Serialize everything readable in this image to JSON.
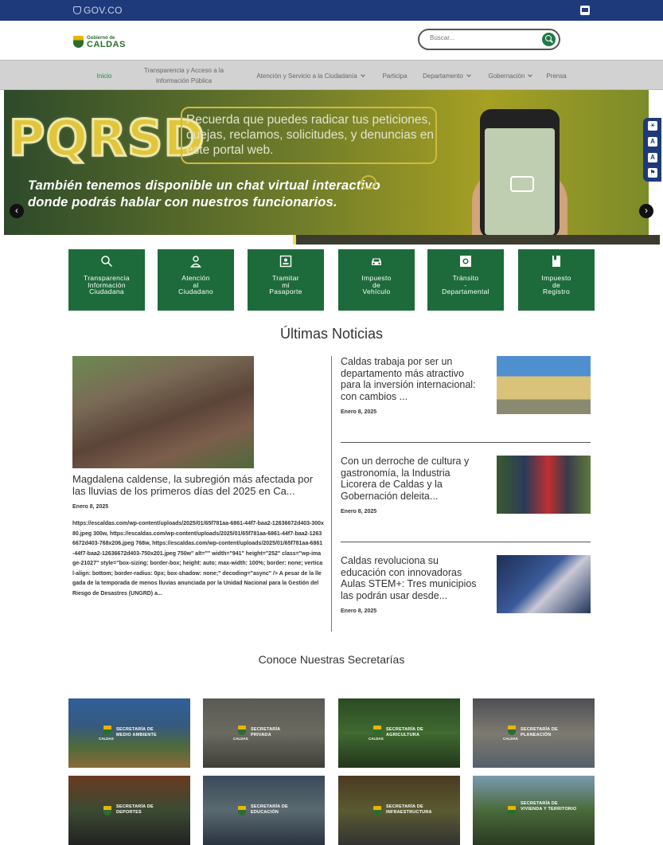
{
  "govbar": {
    "brand": "GOV.CO"
  },
  "logo": {
    "small": "Gobierno de",
    "big": "CALDAS"
  },
  "search": {
    "placeholder": "Buscar..."
  },
  "nav": {
    "items": [
      {
        "label": "Inicio",
        "active": true
      },
      {
        "label": "Transparencia y Acceso a la Información Pública"
      },
      {
        "label": "Atención y Servicio a la Ciudadanía",
        "dropdown": true
      },
      {
        "label": "Participa"
      },
      {
        "label": "Departamento",
        "dropdown": true
      },
      {
        "label": "Gobernación",
        "dropdown": true
      },
      {
        "label": "Prensa"
      }
    ]
  },
  "banner": {
    "headline": "PQRSD",
    "box_text": "Recuerda que puedes radicar tus peticiones, quejas, reclamos, solicitudes, y denuncias en este portal web.",
    "chat_text": "También tenemos disponible un chat virtual interactivo donde podrás hablar con nuestros funcionarios."
  },
  "tiles": [
    {
      "label": "Transparencia\nInformación\nCiudadana",
      "icon": "search-icon"
    },
    {
      "label": "Atención\nal\nCiudadano",
      "icon": "user-icon"
    },
    {
      "label": "Tramitar\nmi\nPasaporte",
      "icon": "id-card-icon"
    },
    {
      "label": "Impuesto\nde\nVehículo",
      "icon": "car-icon"
    },
    {
      "label": "Tránsito\n-\nDepartamental",
      "icon": "camera-icon"
    },
    {
      "label": "Impuesto\nde\nRegistro",
      "icon": "bookmark-icon"
    }
  ],
  "news": {
    "title": "Últimas Noticias",
    "main": {
      "title": "Magdalena caldense, la subregión más afectada por las lluvias de los primeros días del 2025 en Ca...",
      "date": "Enero 8, 2025",
      "excerpt": "https://escaldas.com/wp-content/uploads/2025/01/65f781aa-6861-44f7-baa2-12636672d403-300x80.jpeg 300w, https://escaldas.com/wp-content/uploads/2025/01/65f781aa-6861-44f7-baa2-12636672d403-768x206.jpeg 768w, https://escaldas.com/wp-content/uploads/2025/01/65f781aa-6861-44f7-baa2-12636672d403-750x201.jpeg 750w\" alt=\"\" width=\"941\" height=\"252\" class=\"wp-image-21027\" style=\"box-sizing: border-box; height: auto; max-width: 100%; border: none; vertical-align: bottom; border-radius: 0px; box-shadow: none;\" decoding=\"async\" /> A pesar de la llegada de la temporada de menos lluvias anunciada por la Unidad Nacional para la Gestión del Riesgo de Desastres (UNGRD) a..."
    },
    "items": [
      {
        "title": "Caldas trabaja por ser un departamento más atractivo para la inversión internacional: con cambios ...",
        "date": "Enero 8, 2025"
      },
      {
        "title": "Con un derroche de cultura y gastronomía, la Industria Licorera de Caldas y la Gobernación deleita...",
        "date": "Enero 8, 2025"
      },
      {
        "title": "Caldas revoluciona su educación con innovadoras Aulas STEM+: Tres municipios las podrán usar desde...",
        "date": "Enero 8, 2025"
      }
    ]
  },
  "secretarias": {
    "title": "Conoce Nuestras Secretarías",
    "cards": [
      {
        "label": "SECRETARÍA DE\nMEDIO AMBIENTE"
      },
      {
        "label": "SECRETARÍA\nPRIVADA"
      },
      {
        "label": "SECRETARÍA DE\nAGRICULTURA"
      },
      {
        "label": "SECRETARÍA DE\nPLANEACIÓN"
      },
      {
        "label": "SECRETARÍA DE\nDEPORTES"
      },
      {
        "label": "SECRETARÍA DE\nEDUCACIÓN"
      },
      {
        "label": "SECRETARÍA DE\nINFRAESTRUCTURA"
      },
      {
        "label": "SECRETARÍA DE\nVIVIENDA Y TERRITORIO"
      }
    ],
    "badge_text": "CALDAS"
  },
  "colors": {
    "govbar": "#1e3a7b",
    "tile": "#1d6b3b",
    "nav_active": "#1f8a3f"
  }
}
